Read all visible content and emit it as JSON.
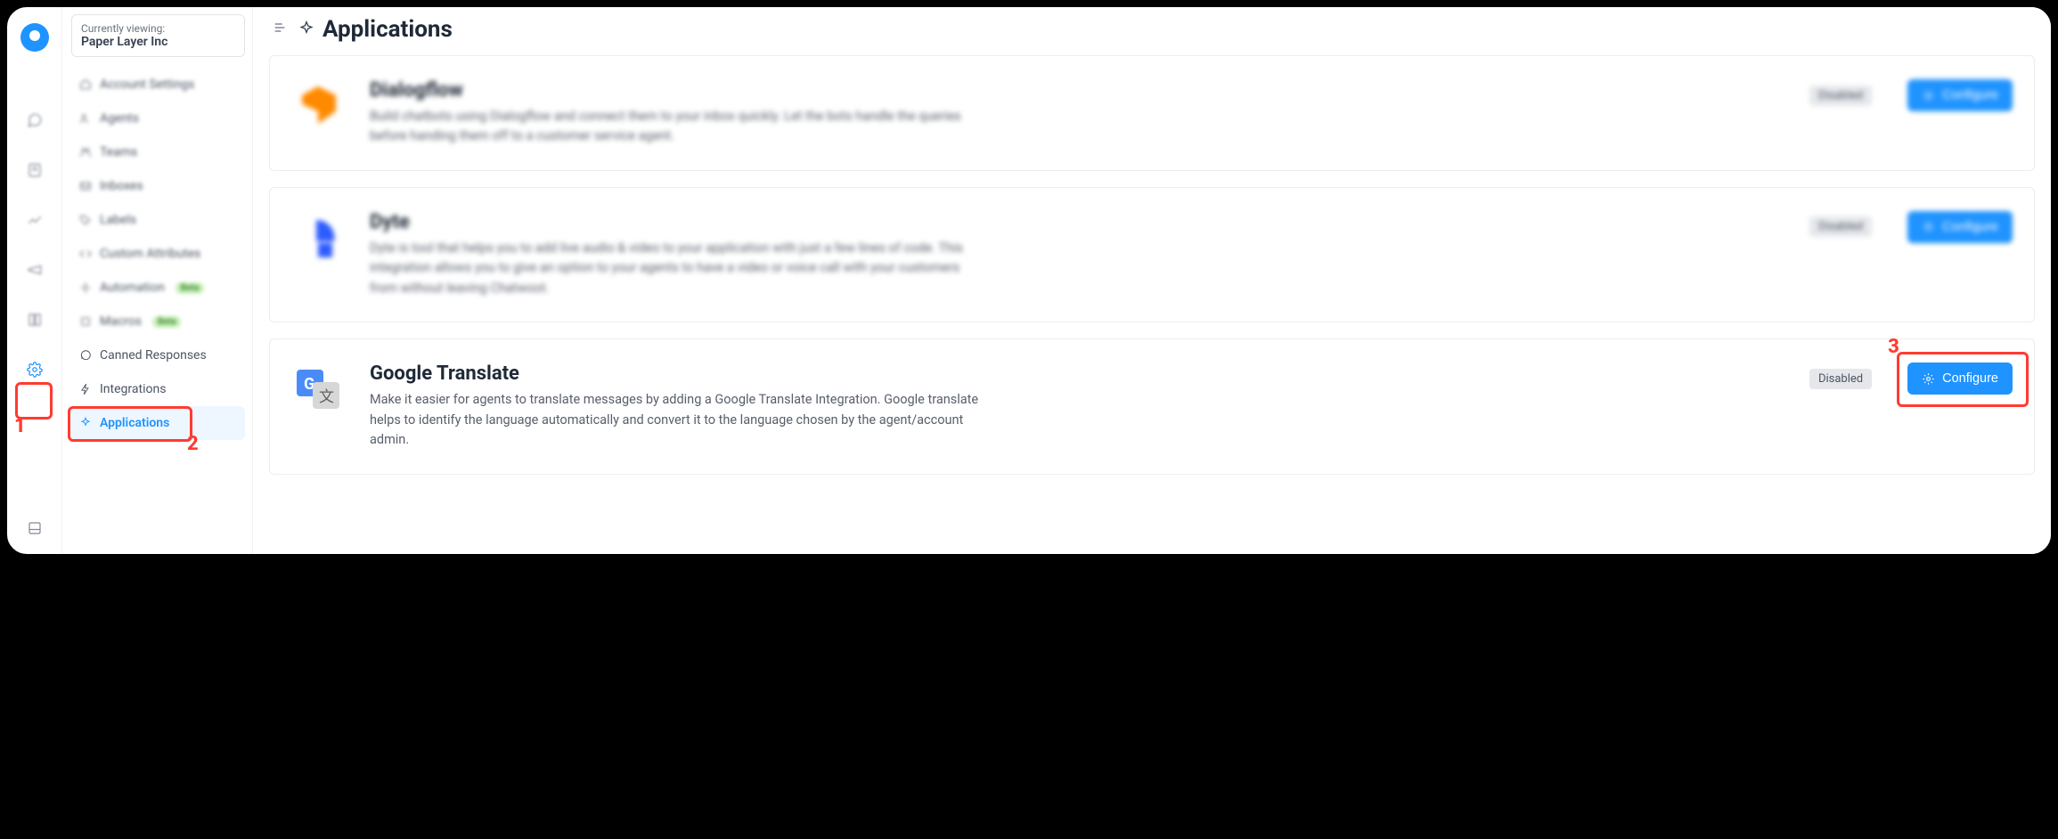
{
  "org_switcher": {
    "label": "Currently viewing:",
    "current": "Paper Layer Inc"
  },
  "sidebar": {
    "items": [
      {
        "label": "Account Settings"
      },
      {
        "label": "Agents"
      },
      {
        "label": "Teams"
      },
      {
        "label": "Inboxes"
      },
      {
        "label": "Labels"
      },
      {
        "label": "Custom Attributes"
      },
      {
        "label": "Automation",
        "badge": "Beta"
      },
      {
        "label": "Macros",
        "badge": "Beta"
      },
      {
        "label": "Canned Responses"
      },
      {
        "label": "Integrations"
      },
      {
        "label": "Applications"
      }
    ]
  },
  "page": {
    "title": "Applications"
  },
  "apps": [
    {
      "name": "Dialogflow",
      "description": "Build chatbots using Dialogflow and connect them to your inbox quickly. Let the bots handle the queries before handing them off to a customer service agent.",
      "status": "Disabled",
      "button": "Configure"
    },
    {
      "name": "Dyte",
      "description": "Dyte is tool that helps you to add live audio & video to your application with just a few lines of code. This integration allows you to give an option to your agents to have a video or voice call with your customers from without leaving Chatwoot.",
      "status": "Disabled",
      "button": "Configure"
    },
    {
      "name": "Google Translate",
      "description": "Make it easier for agents to translate messages by adding a Google Translate Integration. Google translate helps to identify the language automatically and convert it to the language chosen by the agent/account admin.",
      "status": "Disabled",
      "button": "Configure"
    }
  ],
  "annotations": {
    "one": "1",
    "two": "2",
    "three": "3"
  }
}
